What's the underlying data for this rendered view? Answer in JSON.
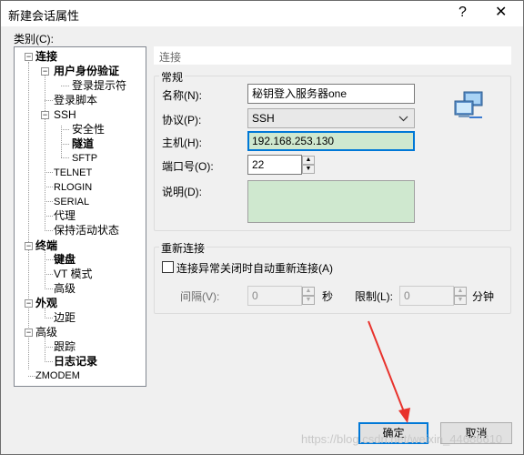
{
  "window": {
    "title": "新建会话属性",
    "help_glyph": "?",
    "close_glyph": "✕"
  },
  "category_label": "类别(C):",
  "tree": {
    "connection": "连接",
    "user_auth": "用户身份验证",
    "login_prompts": "登录提示符",
    "login_script": "登录脚本",
    "ssh": "SSH",
    "security": "安全性",
    "tunnel": "隧道",
    "sftp": "SFTP",
    "telnet": "TELNET",
    "rlogin": "RLOGIN",
    "serial": "SERIAL",
    "proxy": "代理",
    "keepalive": "保持活动状态",
    "terminal": "终端",
    "keyboard": "键盘",
    "vt_mode": "VT 模式",
    "term_advanced": "高级",
    "appearance": "外观",
    "margin": "边距",
    "advanced": "高级",
    "trace": "跟踪",
    "logging": "日志记录",
    "zmodem": "ZMODEM"
  },
  "panel": {
    "header": "连接",
    "general_group": "常规",
    "name_label": "名称(N):",
    "name_value": "秘钥登入服务器one",
    "protocol_label": "协议(P):",
    "protocol_value": "SSH",
    "host_label": "主机(H):",
    "host_value": "192.168.253.130",
    "port_label": "端口号(O):",
    "port_value": "22",
    "desc_label": "说明(D):",
    "desc_value": "",
    "reconnect_group": "重新连接",
    "reconnect_checkbox": "连接异常关闭时自动重新连接(A)",
    "interval_label": "间隔(V):",
    "interval_value": "0",
    "interval_unit": "秒",
    "limit_label": "限制(L):",
    "limit_value": "0",
    "limit_unit": "分钟"
  },
  "buttons": {
    "ok": "确定",
    "cancel": "取消"
  },
  "watermark": "https://blog.csdn.net/weixin_44686610",
  "colors": {
    "desc_bg": "#cfe8cf",
    "accent": "#0078d7",
    "arrow": "#e8322c"
  }
}
